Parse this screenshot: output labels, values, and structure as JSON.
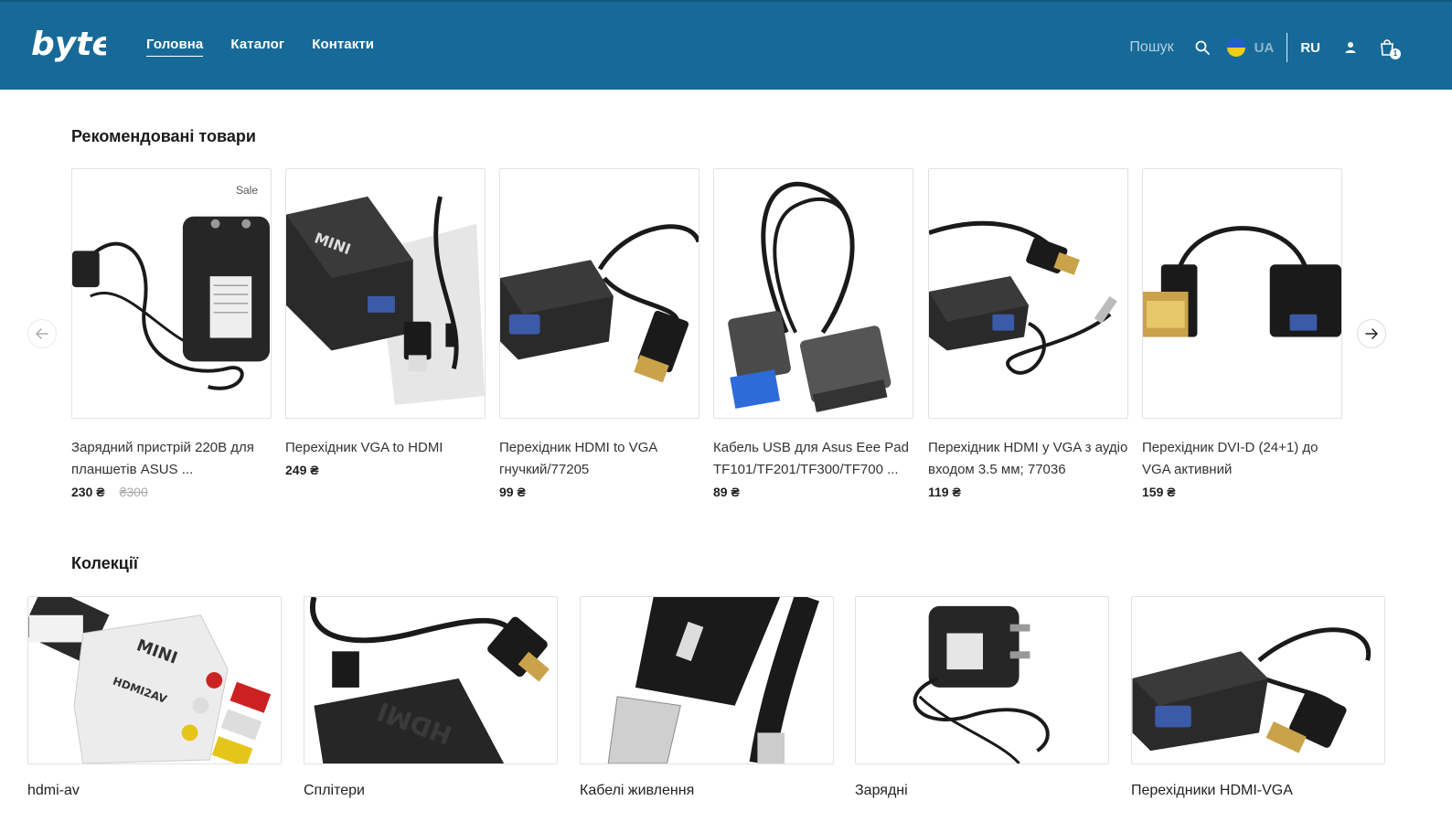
{
  "header": {
    "logo_text": "byte",
    "nav": [
      {
        "label": "Головна",
        "active": true
      },
      {
        "label": "Каталог",
        "active": false
      },
      {
        "label": "Контакти",
        "active": false
      }
    ],
    "search_label": "Пошук",
    "lang_ua": "UA",
    "lang_ru": "RU",
    "cart_count": "1",
    "background_color": "#176a98"
  },
  "recommended": {
    "title": "Рекомендовані товари",
    "products": [
      {
        "name": "Зарядний пристрій 220В для планшетів ASUS ...",
        "price": "230 ₴",
        "old_price": "₴300",
        "badge": "Sale"
      },
      {
        "name": "Перехідник VGA to HDMI",
        "price": "249 ₴"
      },
      {
        "name": "Перехідник HDMI to VGA гнучкий/77205",
        "price": "99 ₴"
      },
      {
        "name": "Кабель USB для Asus Eee Pad TF101/TF201/TF300/TF700 ...",
        "price": "89 ₴"
      },
      {
        "name": "Перехідник HDMI у VGA з аудіо входом 3.5 мм; 77036",
        "price": "119 ₴"
      },
      {
        "name": "Перехідник DVI-D (24+1) до VGA активний",
        "price": "159 ₴"
      }
    ]
  },
  "collections": {
    "title": "Колекції",
    "items": [
      {
        "name": "hdmi-av"
      },
      {
        "name": "Сплітери"
      },
      {
        "name": "Кабелі живлення"
      },
      {
        "name": "Зарядні"
      },
      {
        "name": "Перехідники HDMI-VGA"
      }
    ]
  },
  "icons": {
    "search": "search-icon",
    "user": "user-icon",
    "cart": "cart-icon",
    "prev": "arrow-left-icon",
    "next": "arrow-right-icon"
  }
}
